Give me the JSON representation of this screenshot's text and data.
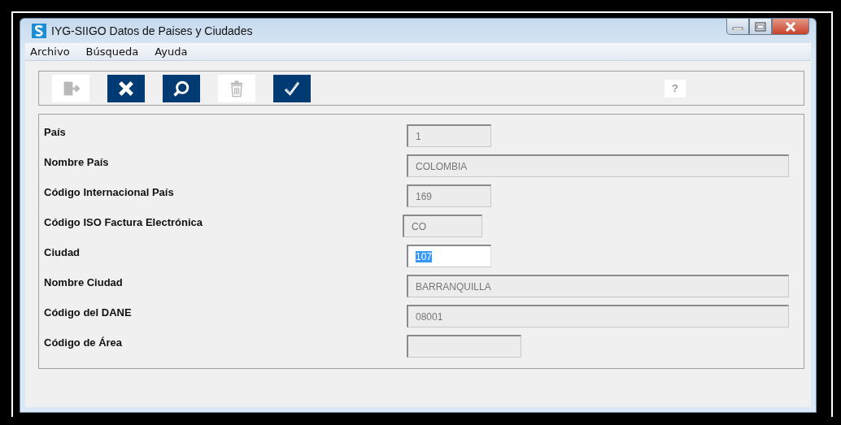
{
  "window": {
    "title": "IYG-SIIGO Datos de Paises y Ciudades"
  },
  "menu": [
    {
      "label": "Archivo"
    },
    {
      "label": "Búsqueda"
    },
    {
      "label": "Ayuda"
    }
  ],
  "toolbar": [
    {
      "kind": "exit",
      "disabled": true
    },
    {
      "kind": "cancel",
      "disabled": false
    },
    {
      "kind": "search",
      "disabled": false
    },
    {
      "kind": "delete",
      "disabled": true
    },
    {
      "kind": "confirm",
      "disabled": false
    }
  ],
  "help_button": {
    "label": "?",
    "disabled": true
  },
  "fields": [
    {
      "label": "País",
      "value": "1",
      "kind": "short",
      "disabled": true,
      "text_selected": false
    },
    {
      "label": "Nombre País",
      "value": "COLOMBIA",
      "kind": "long",
      "disabled": true,
      "text_selected": false
    },
    {
      "label": "Código Internacional País",
      "value": "169",
      "kind": "short",
      "disabled": true,
      "text_selected": false
    },
    {
      "label": "Código ISO Factura Electrónica",
      "value": "CO",
      "kind": "tiny",
      "disabled": true,
      "text_selected": false
    },
    {
      "label": "Ciudad",
      "value": "107",
      "kind": "short",
      "disabled": false,
      "text_selected": true
    },
    {
      "label": "Nombre Ciudad",
      "value": "BARRANQUILLA",
      "kind": "long",
      "disabled": true,
      "text_selected": false
    },
    {
      "label": "Código del DANE",
      "value": "08001",
      "kind": "long",
      "disabled": true,
      "text_selected": false
    },
    {
      "label": "Código de Área",
      "kind": "medium",
      "disabled": true,
      "text_selected": false
    }
  ]
}
